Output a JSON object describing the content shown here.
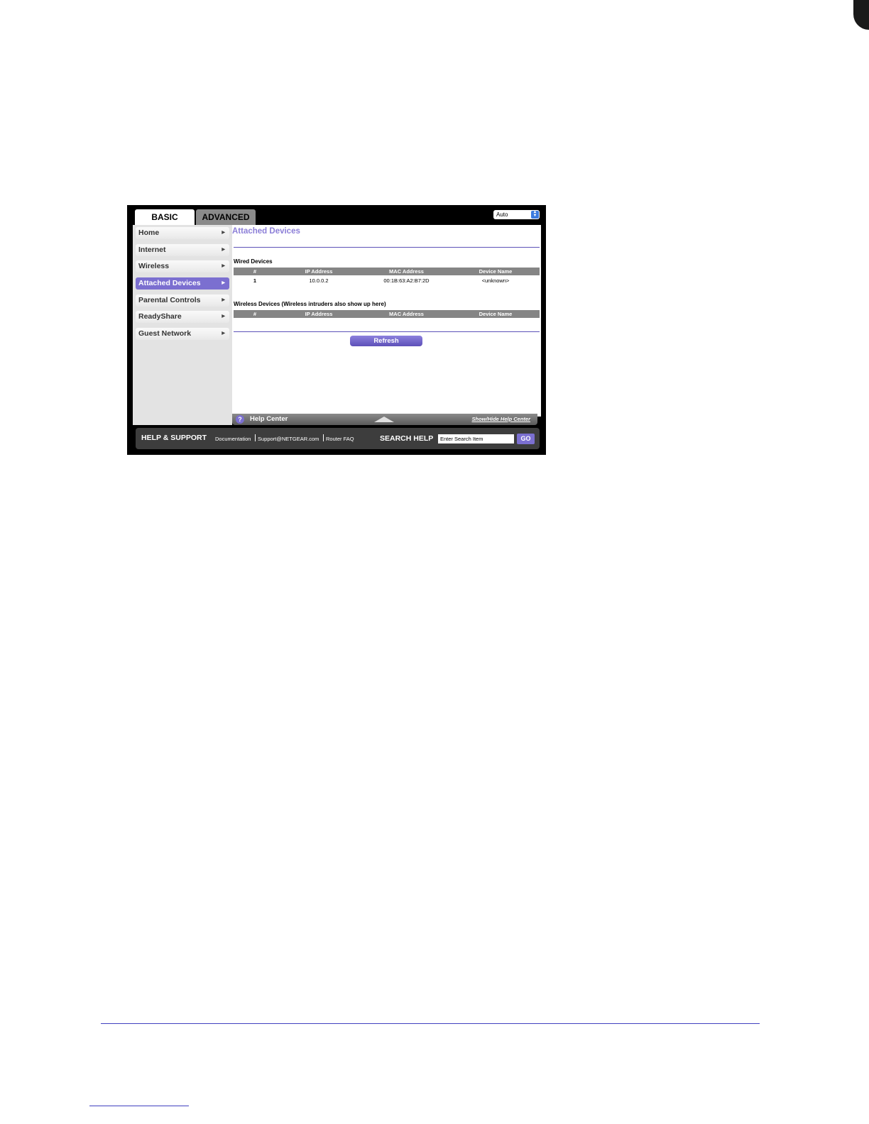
{
  "tabs": {
    "basic": "BASIC",
    "advanced": "ADVANCED"
  },
  "language": {
    "selected": "Auto"
  },
  "sidebar": {
    "items": [
      {
        "label": "Home"
      },
      {
        "label": "Internet"
      },
      {
        "label": "Wireless"
      },
      {
        "label": "Attached Devices",
        "active": true
      },
      {
        "label": "Parental Controls"
      },
      {
        "label": "ReadyShare"
      },
      {
        "label": "Guest Network"
      }
    ]
  },
  "main": {
    "title": "Attached Devices",
    "wired": {
      "title": "Wired Devices",
      "columns": [
        "#",
        "IP Address",
        "MAC Address",
        "Device Name"
      ],
      "rows": [
        {
          "num": "1",
          "ip": "10.0.0.2",
          "mac": "00:1B:63:A2:B7:2D",
          "name": "<unknown>"
        }
      ]
    },
    "wireless": {
      "title": "Wireless Devices (Wireless intruders also show up here)",
      "columns": [
        "#",
        "IP Address",
        "MAC Address",
        "Device Name"
      ]
    },
    "refresh_label": "Refresh"
  },
  "help_center": {
    "title": "Help Center",
    "toggle": "Show/Hide Help Center"
  },
  "support": {
    "title": "HELP & SUPPORT",
    "links": [
      "Documentation",
      "Support@NETGEAR.com",
      "Router FAQ"
    ],
    "search_title": "SEARCH HELP",
    "search_value": "Enter Search Item",
    "go_label": "GO"
  },
  "colors": {
    "accent": "#7b6fd0",
    "title": "#8c7fd8",
    "table_header": "#858585",
    "dark": "#3d3d3d"
  }
}
